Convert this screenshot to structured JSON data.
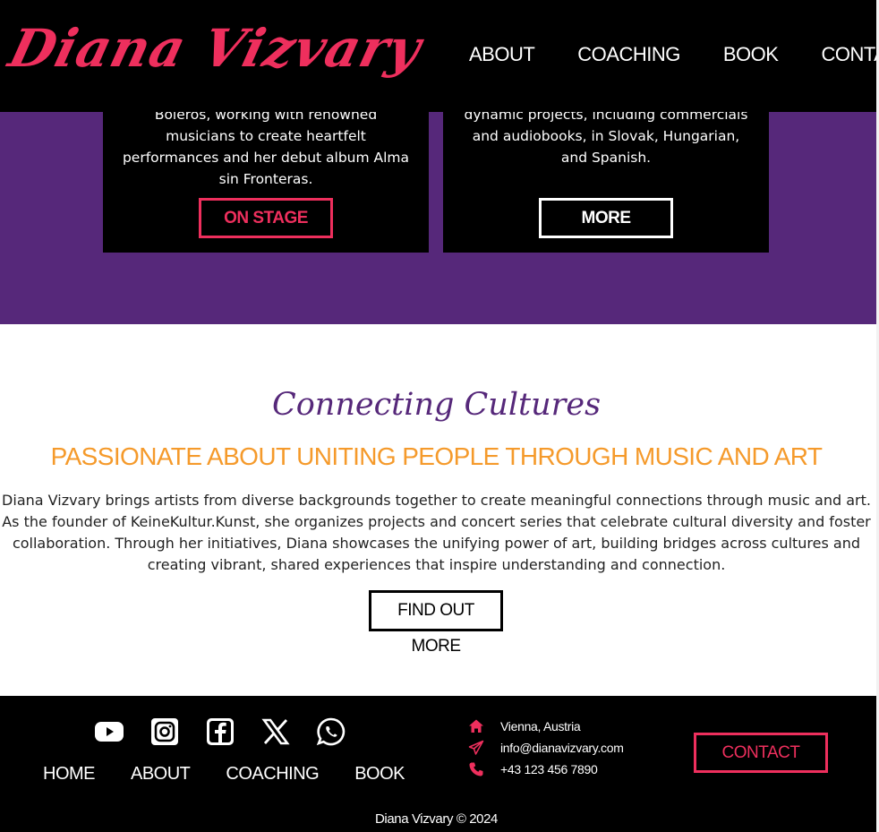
{
  "header": {
    "logo": "Diana Vizvary",
    "nav": [
      "ABOUT",
      "COACHING",
      "BOOK",
      "CONTACT"
    ]
  },
  "cards": {
    "left": {
      "text": "Boleros, working with renowned musicians to create heartfelt performances and her debut album Alma sin Fronteras.",
      "button": "ON STAGE"
    },
    "right": {
      "text": "dynamic projects, including commercials and audiobooks, in Slovak, Hungarian, and Spanish.",
      "button": "MORE"
    }
  },
  "culture": {
    "script_heading": "Connecting Cultures",
    "subheading": "PASSIONATE ABOUT UNITING PEOPLE THROUGH MUSIC AND ART",
    "body": "Diana Vizvary brings artists from diverse backgrounds together to create meaningful connections through music and art. As the founder of KeineKultur.Kunst, she organizes projects and concert series that celebrate cultural diversity and foster collaboration. Through her initiatives, Diana showcases the unifying power of art, building bridges across cultures and creating vibrant, shared experiences that inspire understanding and connection.",
    "button": "FIND OUT MORE"
  },
  "footer": {
    "social": [
      "youtube-icon",
      "instagram-icon",
      "facebook-icon",
      "x-icon",
      "whatsapp-icon"
    ],
    "nav": [
      "HOME",
      "ABOUT",
      "COACHING",
      "BOOK"
    ],
    "location": "Vienna, Austria",
    "email": "info@dianavizvary.com",
    "phone": "+43 123 456 7890",
    "contact_button": "CONTACT",
    "copyright": "Diana Vizvary © 2024"
  },
  "colors": {
    "accent": "#ee2f5d",
    "purple": "#56287a",
    "orange": "#f59a2b",
    "black": "#000000"
  }
}
